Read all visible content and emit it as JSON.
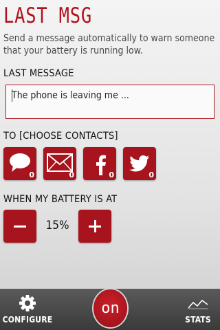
{
  "header": {
    "title": "LAST MSG",
    "subtitle": "Send a message automatically to warn someone that your battery is running low."
  },
  "message": {
    "label": "LAST MESSAGE",
    "value": "The phone is leaving me ..."
  },
  "contacts": {
    "label": "TO [CHOOSE CONTACTS]",
    "items": [
      {
        "icon": "speech-bubble-icon",
        "count": "0"
      },
      {
        "icon": "envelope-icon",
        "count": "0"
      },
      {
        "icon": "facebook-icon",
        "count": "0"
      },
      {
        "icon": "twitter-bird-icon",
        "count": "0"
      }
    ]
  },
  "battery": {
    "label": "WHEN MY BATTERY IS AT",
    "value": "15%"
  },
  "bottom_bar": {
    "configure_label": "CONFIGURE",
    "on_label": "on",
    "stats_label": "STATS"
  },
  "colors": {
    "accent": "#a8141d",
    "bar": "#474747"
  }
}
